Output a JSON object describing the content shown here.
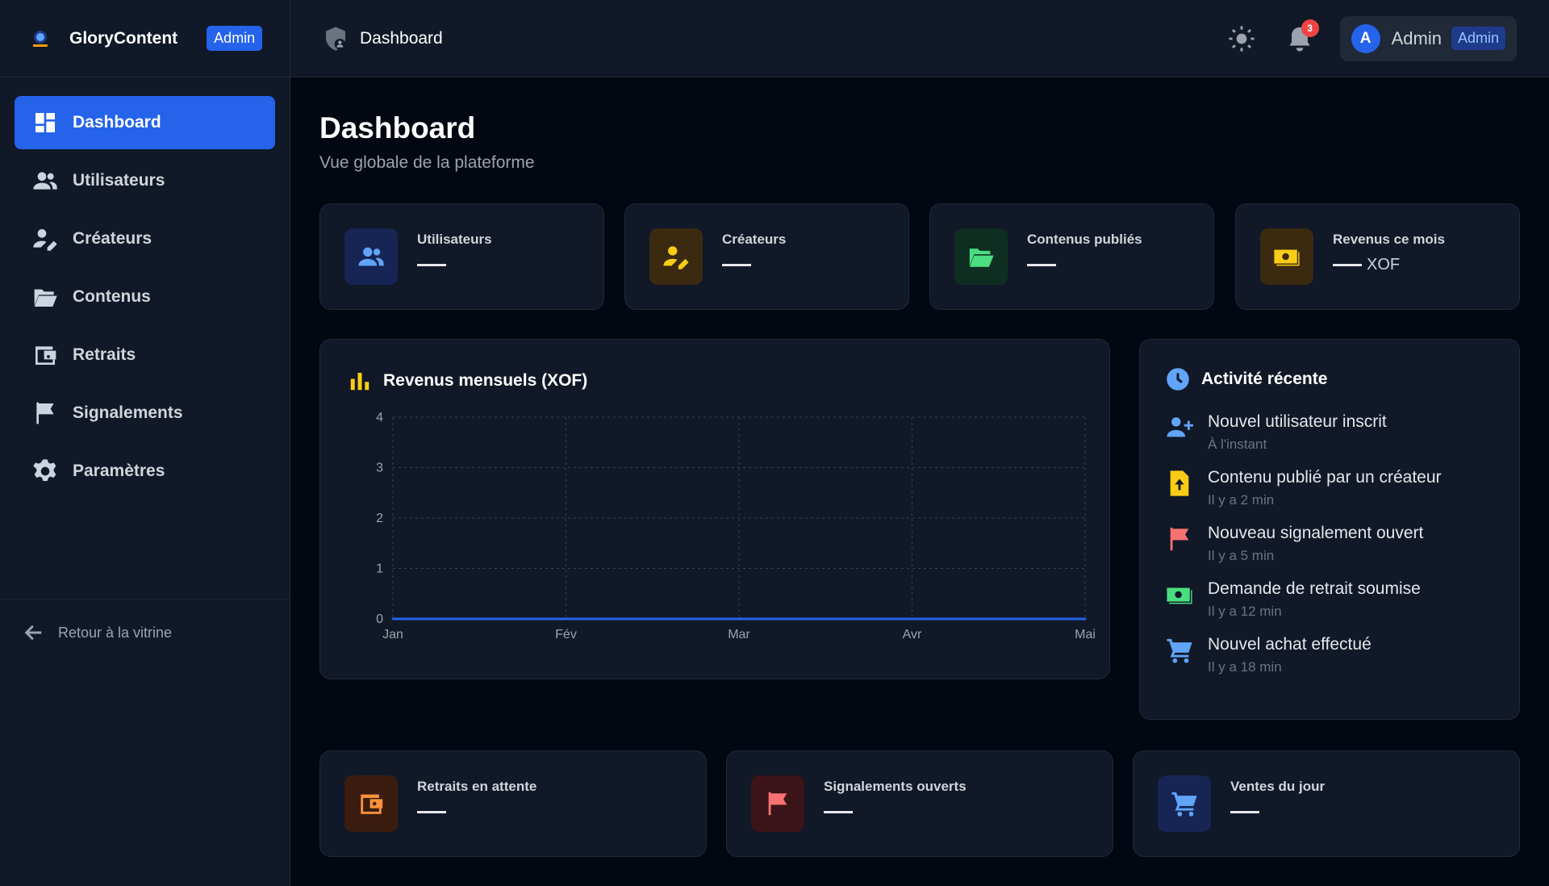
{
  "brand": {
    "name": "GloryContent",
    "badge": "Admin"
  },
  "sidebar": {
    "items": [
      {
        "label": "Dashboard",
        "icon": "dashboard-icon",
        "active": true
      },
      {
        "label": "Utilisateurs",
        "icon": "users-icon"
      },
      {
        "label": "Créateurs",
        "icon": "user-edit-icon"
      },
      {
        "label": "Contenus",
        "icon": "folder-open-icon"
      },
      {
        "label": "Retraits",
        "icon": "wallet-icon"
      },
      {
        "label": "Signalements",
        "icon": "flag-icon"
      },
      {
        "label": "Paramètres",
        "icon": "gear-icon"
      }
    ],
    "back_label": "Retour à la vitrine"
  },
  "header": {
    "title": "Dashboard",
    "notifications_count": "3",
    "user": {
      "initial": "A",
      "name": "Admin",
      "role": "Admin"
    }
  },
  "page": {
    "title": "Dashboard",
    "subtitle": "Vue globale de la plateforme"
  },
  "stats": [
    {
      "label": "Utilisateurs",
      "value": "—",
      "unit": ""
    },
    {
      "label": "Créateurs",
      "value": "—",
      "unit": ""
    },
    {
      "label": "Contenus publiés",
      "value": "—",
      "unit": ""
    },
    {
      "label": "Revenus ce mois",
      "value": "—",
      "unit": "XOF"
    }
  ],
  "bottom_stats": [
    {
      "label": "Retraits en attente",
      "value": "—"
    },
    {
      "label": "Signalements ouverts",
      "value": "—"
    },
    {
      "label": "Ventes du jour",
      "value": "—"
    }
  ],
  "activity": {
    "title": "Activité récente",
    "items": [
      {
        "title": "Nouvel utilisateur inscrit",
        "time": "À l'instant",
        "icon": "user-plus-icon"
      },
      {
        "title": "Contenu publié par un créateur",
        "time": "Il y a 2 min",
        "icon": "file-upload-icon"
      },
      {
        "title": "Nouveau signalement ouvert",
        "time": "Il y a 5 min",
        "icon": "flag-icon"
      },
      {
        "title": "Demande de retrait soumise",
        "time": "Il y a 12 min",
        "icon": "money-icon"
      },
      {
        "title": "Nouvel achat effectué",
        "time": "Il y a 18 min",
        "icon": "cart-icon"
      }
    ]
  },
  "colors": {
    "accent": "#2563eb",
    "background": "#030712",
    "card": "#111827"
  },
  "chart_data": {
    "type": "line",
    "title": "Revenus mensuels (XOF)",
    "categories": [
      "Jan",
      "Fév",
      "Mar",
      "Avr",
      "Mai"
    ],
    "series": [
      {
        "values": [
          0,
          0,
          0,
          0,
          0
        ]
      }
    ],
    "ylim": [
      0,
      4
    ],
    "yticks": [
      "0",
      "1",
      "2",
      "3",
      "4"
    ],
    "grid": true,
    "line_color": "#2563eb"
  }
}
